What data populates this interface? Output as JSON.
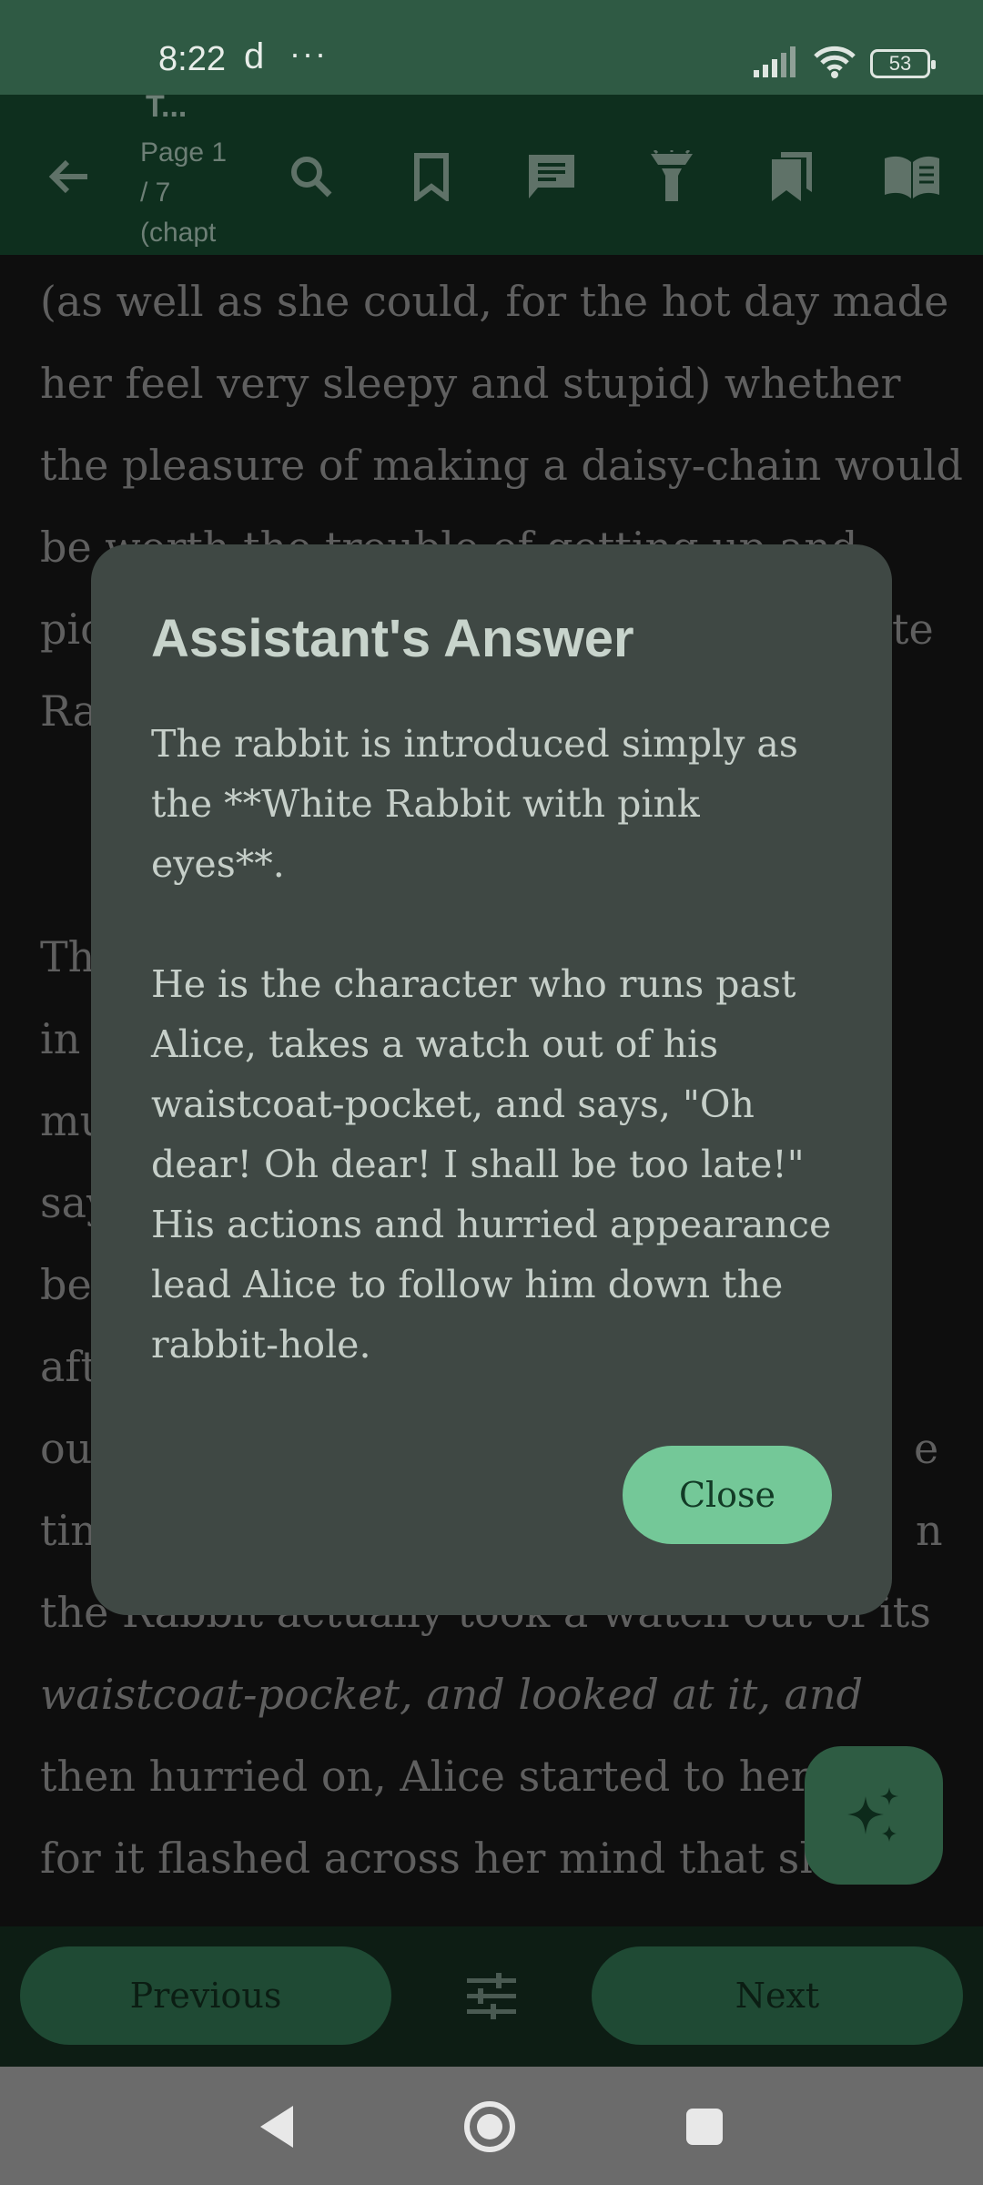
{
  "status_bar": {
    "time": "8:22",
    "carrier_glyph": "d",
    "more": "···",
    "battery": "53",
    "icons": [
      "signal-icon",
      "wifi-icon",
      "battery-icon"
    ]
  },
  "toolbar": {
    "title_fragment": "T...",
    "page_info": "Page 1 / 7 (chapt",
    "icons": [
      "back-arrow-icon",
      "search-icon",
      "bookmark-icon",
      "notes-icon",
      "flashlight-icon",
      "bookmarks-icon",
      "book-open-icon"
    ]
  },
  "content": {
    "lines": [
      "(as well as she could, for the hot day made",
      "her feel very sleepy and stupid) whether",
      "the pleasure of making a daisy-chain would",
      "be worth the trouble of getting up and",
      "pic",
      "te",
      "Ra",
      "Th",
      "in",
      "mu",
      "say",
      "be",
      "aft",
      "ou",
      "e",
      "tim",
      "n",
      "the Rabbit actually took a watch out of its",
      "waistcoat-pocket, and looked at it, and",
      "then hurried on, Alice started to her f",
      "for it flashed across her mind that she"
    ]
  },
  "dialog": {
    "title": "Assistant's Answer",
    "body": "The rabbit is introduced simply as the **White Rabbit with pink eyes**.\n\nHe is the character who runs past Alice, takes a watch out of his waistcoat-pocket, and says, \"Oh dear! Oh dear! I shall be too late!\" His actions and hurried appearance lead Alice to follow him down the rabbit-hole.",
    "close_label": "Close"
  },
  "bottom_bar": {
    "previous_label": "Previous",
    "next_label": "Next",
    "settings_icon": "sliders-icon"
  },
  "fab": {
    "icon": "sparkle-icon"
  },
  "nav_bar": {
    "icons": [
      "nav-back-icon",
      "nav-home-icon",
      "nav-recents-icon"
    ]
  },
  "colors": {
    "accent": "#74c898",
    "dialog_bg": "#3f4844",
    "toolbar_bg": "#0e2f1e",
    "status_bg": "#2f5a44"
  }
}
